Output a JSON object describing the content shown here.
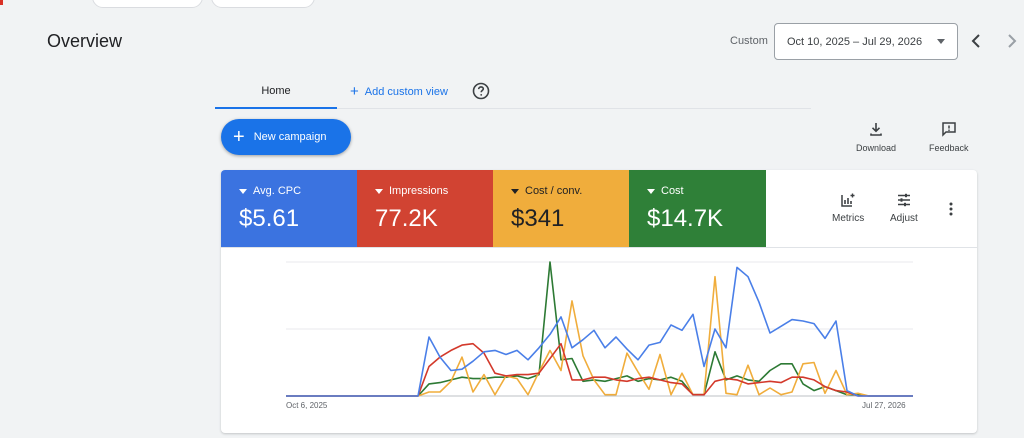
{
  "page": {
    "title": "Overview"
  },
  "date_range": {
    "label": "Custom",
    "value": "Oct 10, 2025 – Jul 29, 2026"
  },
  "tabs": {
    "home": "Home",
    "add_custom_view": "Add custom view"
  },
  "actions": {
    "new_campaign": "New campaign",
    "download": "Download",
    "feedback": "Feedback",
    "metrics": "Metrics",
    "adjust": "Adjust"
  },
  "metrics": [
    {
      "label": "Avg. CPC",
      "value": "$5.61",
      "color": "#3b73e0"
    },
    {
      "label": "Impressions",
      "value": "77.2K",
      "color": "#d14332"
    },
    {
      "label": "Cost / conv.",
      "value": "$341",
      "color": "#f0ad3c"
    },
    {
      "label": "Cost",
      "value": "$14.7K",
      "color": "#2f8038"
    }
  ],
  "chart_data": {
    "type": "line",
    "x_start_label": "Oct 6, 2025",
    "x_end_label": "Jul 27, 2026",
    "ylim": [
      0,
      1
    ],
    "grid": true,
    "series": [
      {
        "name": "Avg. CPC",
        "color": "#4a7fe8",
        "values": [
          0,
          0,
          0,
          0,
          0,
          0,
          0,
          0,
          0,
          0,
          0,
          0,
          0,
          0.44,
          0.29,
          0.19,
          0.2,
          0.26,
          0.33,
          0.34,
          0.31,
          0.34,
          0.27,
          0.36,
          0.46,
          0.59,
          0.36,
          0.42,
          0.49,
          0.36,
          0.44,
          0.35,
          0.27,
          0.38,
          0.4,
          0.53,
          0.49,
          0.61,
          0.22,
          0.5,
          0.36,
          0.96,
          0.89,
          0.7,
          0.47,
          0.52,
          0.57,
          0.56,
          0.54,
          0.43,
          0.56,
          0.04,
          0,
          0,
          0,
          0,
          0,
          0
        ]
      },
      {
        "name": "Impressions",
        "color": "#d3392b",
        "values": [
          0,
          0,
          0,
          0,
          0,
          0,
          0,
          0,
          0,
          0,
          0,
          0,
          0,
          0.22,
          0.29,
          0.34,
          0.38,
          0.39,
          0.32,
          0.17,
          0.15,
          0.16,
          0.16,
          0.17,
          0.28,
          0.39,
          0.12,
          0.12,
          0.14,
          0.14,
          0.12,
          0.11,
          0.13,
          0.14,
          0.12,
          0.1,
          0.09,
          0.01,
          0.01,
          0.11,
          0.13,
          0.12,
          0.09,
          0.1,
          0.11,
          0.1,
          0.14,
          0.14,
          0.12,
          0.07,
          0.04,
          0.03,
          0,
          0,
          0,
          0,
          0,
          0
        ]
      },
      {
        "name": "Cost / conv.",
        "color": "#f0ad3c",
        "values": [
          0,
          0,
          0,
          0,
          0,
          0,
          0,
          0,
          0,
          0,
          0,
          0,
          0,
          0.03,
          0.03,
          0.11,
          0.29,
          0.03,
          0.16,
          0.01,
          0.15,
          0.13,
          0.01,
          0.18,
          0.34,
          0.19,
          0.71,
          0.3,
          0.12,
          0.01,
          0.01,
          0.32,
          0.18,
          0.05,
          0.31,
          0.01,
          0.17,
          0.01,
          0.01,
          0.89,
          0.02,
          0.01,
          0.23,
          0.01,
          0.06,
          0.01,
          0.03,
          0.24,
          0.25,
          0.02,
          0.19,
          0.01,
          0.02,
          0,
          0,
          0,
          0,
          0
        ]
      },
      {
        "name": "Cost",
        "color": "#2d7a34",
        "values": [
          0,
          0,
          0,
          0,
          0,
          0,
          0,
          0,
          0,
          0,
          0,
          0,
          0,
          0.09,
          0.1,
          0.12,
          0.14,
          0.13,
          0.13,
          0.14,
          0.14,
          0.15,
          0.13,
          0.16,
          1.0,
          0.27,
          0.28,
          0.11,
          0.12,
          0.11,
          0.13,
          0.15,
          0.11,
          0.13,
          0.12,
          0.14,
          0.11,
          0.01,
          0.01,
          0.33,
          0.12,
          0.15,
          0.12,
          0.11,
          0.19,
          0.24,
          0.24,
          0.09,
          0.04,
          0.07,
          0.04,
          0.01,
          0.01,
          0,
          0,
          0,
          0,
          0
        ]
      }
    ]
  }
}
